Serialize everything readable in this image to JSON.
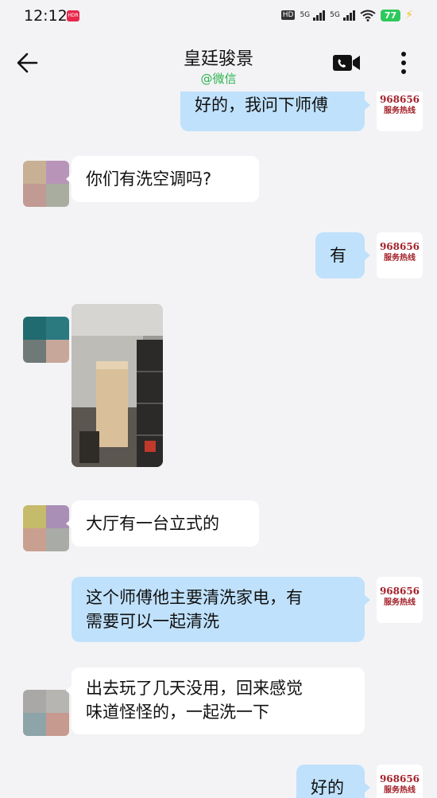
{
  "status": {
    "time": "12:12",
    "badge": "HDR",
    "hd": "HD",
    "net1": "5G",
    "net2": "5G",
    "battery": "77"
  },
  "header": {
    "title": "皇廷骏景",
    "subtitle": "@微信"
  },
  "hotline": {
    "number": "968656",
    "label": "服务热线"
  },
  "messages": [
    {
      "side": "out",
      "text": "好的，我问下师傅"
    },
    {
      "side": "in",
      "text": "你们有洗空调吗?"
    },
    {
      "side": "out",
      "text": "有"
    },
    {
      "side": "in",
      "type": "image"
    },
    {
      "side": "in",
      "text": "大厅有一台立式的"
    },
    {
      "side": "out",
      "lines": [
        "这个师傅他主要清洗家电，有",
        "需要可以一起清洗"
      ]
    },
    {
      "side": "in",
      "lines": [
        "出去玩了几天没用，回来感觉",
        "味道怪怪的，一起洗一下"
      ]
    },
    {
      "side": "out",
      "text": "好的"
    }
  ],
  "colors": {
    "background": "#f3f3f5",
    "outgoing_bubble": "#bfe1fb",
    "incoming_bubble": "#ffffff",
    "subtitle_green": "#2cb34f",
    "hotline_red": "#a3212a"
  }
}
